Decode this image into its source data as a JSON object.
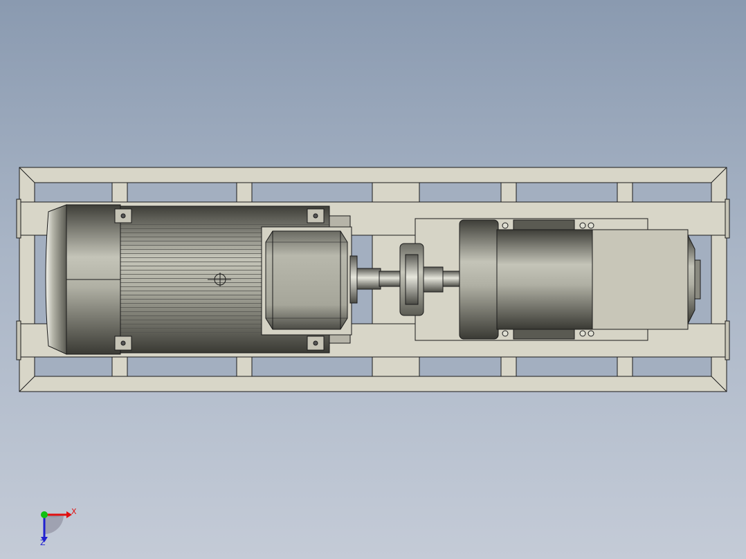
{
  "viewport": {
    "background_top": "#8a9ab0",
    "background_bottom": "#c4cbd7"
  },
  "model": {
    "frame_color": "#d8d6c8",
    "motor_body_color": "#9a9a90",
    "shaded_dark": "#4a4a44",
    "outline_color": "#1a1a1a"
  },
  "triad": {
    "x_label": "X",
    "z_label": "Z",
    "x_color": "#e01010",
    "y_color": "#10c010",
    "z_color": "#2020d0"
  }
}
